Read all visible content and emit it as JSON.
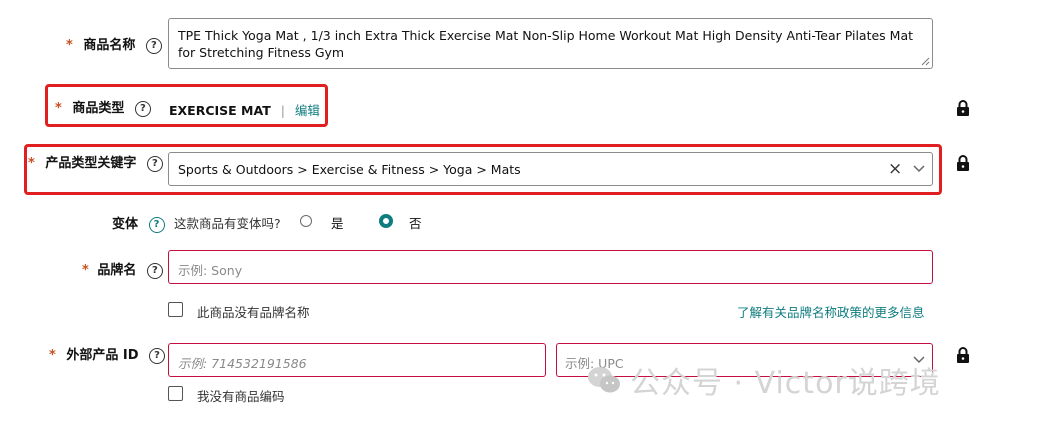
{
  "product_name": {
    "label": "商品名称",
    "value": "TPE Thick Yoga Mat , 1/3 inch Extra Thick Exercise Mat Non-Slip Home Workout Mat High Density Anti-Tear Pilates Mat for Stretching Fitness Gym"
  },
  "product_type": {
    "label": "商品类型",
    "value": "EXERCISE MAT",
    "separator": "|",
    "edit_label": "编辑"
  },
  "type_keyword": {
    "label": "产品类型关键字",
    "value": "Sports & Outdoors > Exercise & Fitness > Yoga > Mats",
    "clear": "×"
  },
  "variation": {
    "label": "变体",
    "question": "这款商品有变体吗?",
    "option_yes": "是",
    "option_no": "否",
    "selected": "否"
  },
  "brand": {
    "label": "品牌名",
    "placeholder": "示例: Sony",
    "no_brand_label": "此商品没有品牌名称",
    "learn_more": "了解有关品牌名称政策的更多信息"
  },
  "external_id": {
    "label": "外部产品 ID",
    "placeholder": "示例: 714532191586",
    "type_placeholder": "示例: UPC",
    "no_code_label": "我没有商品编码"
  },
  "common": {
    "required_mark": "*",
    "help_glyph": "?"
  },
  "watermark": {
    "text": "公众号 · Victor说跨境"
  },
  "colors": {
    "accent": "#0f7c80",
    "highlight": "#e02020",
    "error_border": "#c40f3f",
    "required": "#c7511f"
  }
}
